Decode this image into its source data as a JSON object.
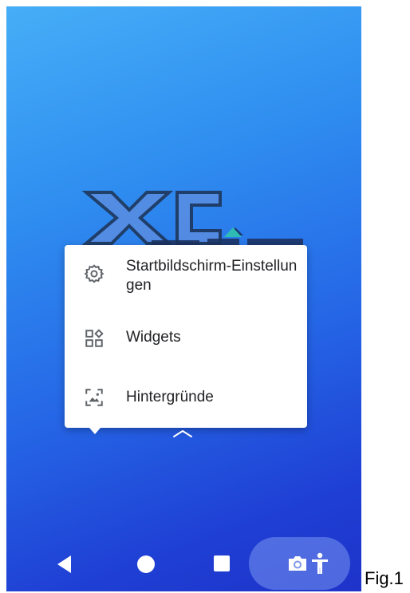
{
  "context_menu": {
    "items": [
      {
        "label": "Startbildschirm-Einstellungen",
        "icon": "gear-icon"
      },
      {
        "label": "Widgets",
        "icon": "widgets-icon"
      },
      {
        "label": "Hintergründe",
        "icon": "wallpaper-icon"
      }
    ]
  },
  "wallpaper": {
    "logo_text": "XC",
    "gradient_top": "#46aef7",
    "gradient_bottom": "#1e33c9"
  },
  "navbar": {
    "back": "back-icon",
    "home": "home-icon",
    "recents": "recents-icon"
  },
  "floating_pill": {
    "camera": "camera-icon",
    "accessibility": "accessibility-icon"
  },
  "caption": "Fig.1"
}
